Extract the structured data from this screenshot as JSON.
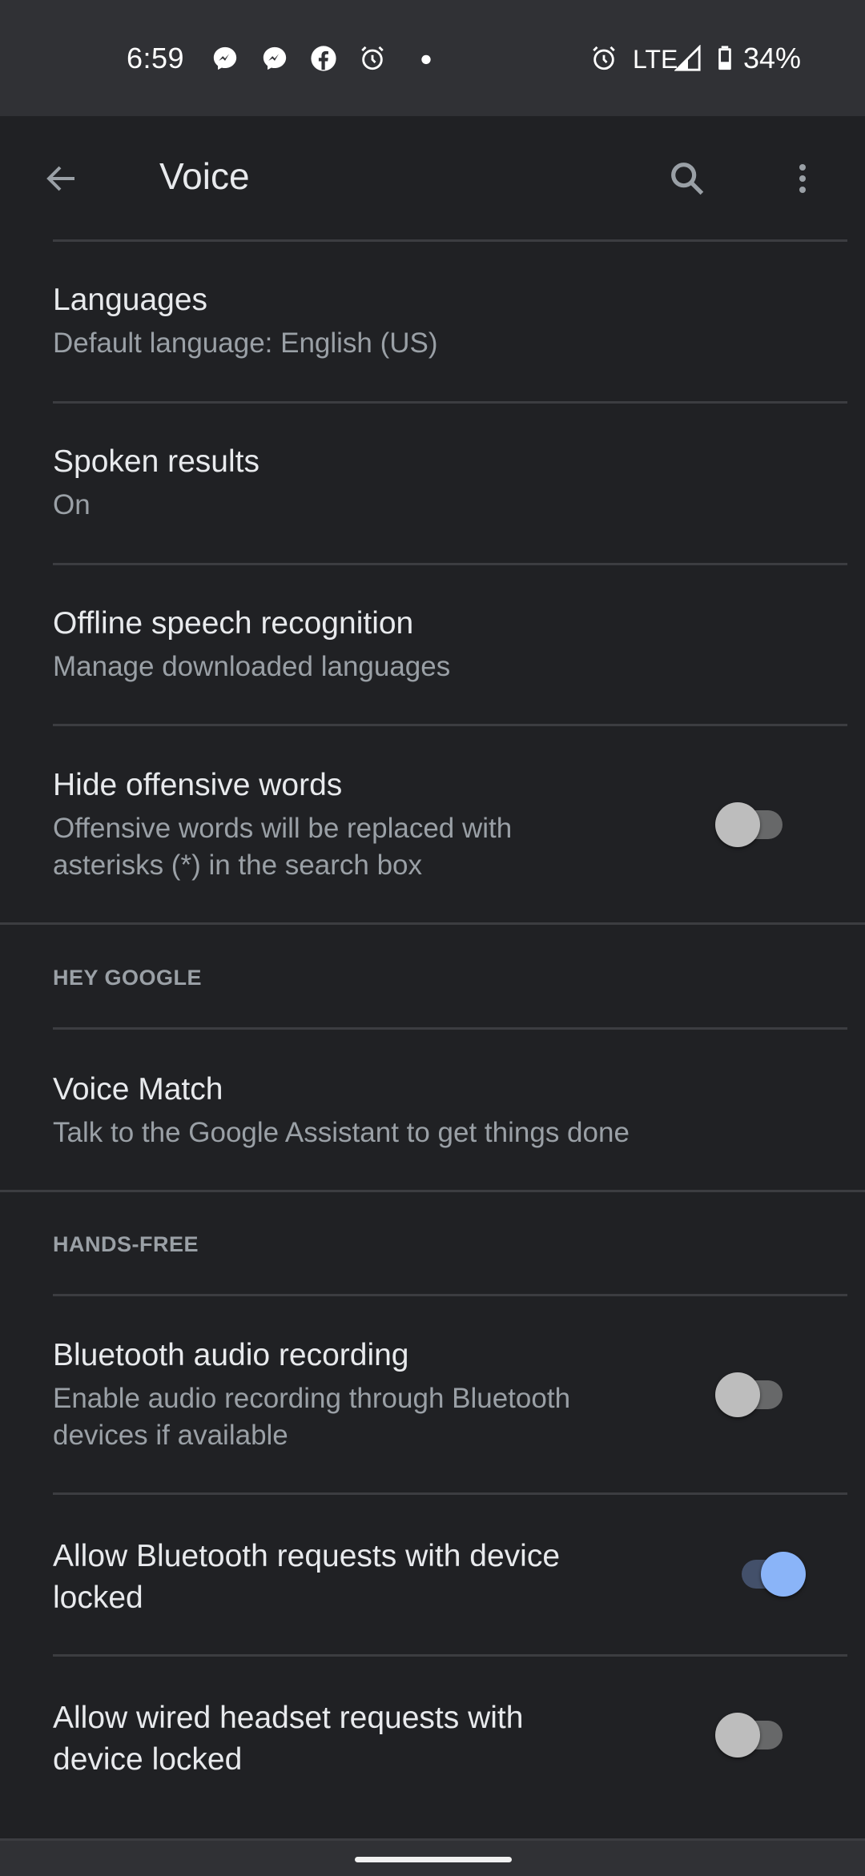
{
  "status_bar": {
    "time": "6:59",
    "notification_icons": [
      "messenger-icon",
      "messenger-icon",
      "facebook-icon",
      "alarm-icon",
      "dot-icon"
    ],
    "alarm_icon": "alarm-icon",
    "network": "LTE",
    "signal_icon": "signal-icon",
    "battery_icon": "battery-icon",
    "battery": "34%"
  },
  "app_bar": {
    "back_icon": "arrow-back-icon",
    "title": "Voice",
    "search_icon": "search-icon",
    "more_icon": "more-vert-icon"
  },
  "settings": {
    "languages": {
      "title": "Languages",
      "subtitle": "Default language: English (US)"
    },
    "spoken_results": {
      "title": "Spoken results",
      "subtitle": "On"
    },
    "offline_speech": {
      "title": "Offline speech recognition",
      "subtitle": "Manage downloaded languages"
    },
    "hide_offensive": {
      "title": "Hide offensive words",
      "subtitle_line1": "Offensive words will be replaced with",
      "subtitle_line2": "asterisks (*) in the search box",
      "enabled": false
    },
    "hey_google_header": "HEY GOOGLE",
    "voice_match": {
      "title": "Voice Match",
      "subtitle": "Talk to the Google Assistant to get things done"
    },
    "hands_free_header": "HANDS-FREE",
    "bluetooth_audio": {
      "title": "Bluetooth audio recording",
      "subtitle_line1": "Enable audio recording through Bluetooth",
      "subtitle_line2": "devices if available",
      "enabled": false
    },
    "bluetooth_locked": {
      "title_line1": "Allow Bluetooth requests with device",
      "title_line2": "locked",
      "enabled": true
    },
    "wired_locked": {
      "title_line1": "Allow wired headset requests with",
      "title_line2": "device locked",
      "enabled": false
    }
  },
  "colors": {
    "background": "#202124",
    "status_bar": "#303135",
    "accent": "#8ab4f8",
    "primary_text": "#e8eaed",
    "secondary_text": "#9aa0a6",
    "divider": "#3c3d41"
  }
}
